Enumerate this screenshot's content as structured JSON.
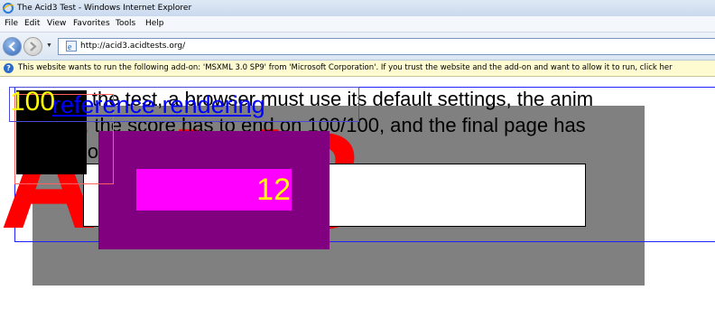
{
  "window": {
    "title": "The Acid3 Test - Windows Internet Explorer"
  },
  "menu": [
    "File",
    "Edit",
    "View",
    "Favorites",
    "Tools",
    "Help"
  ],
  "address": {
    "url": "http://acid3.acidtests.org/"
  },
  "infobar": {
    "text": "This website wants to run the following add-on: 'MSXML 3.0 SP9' from 'Microsoft Corporation'. If you trust the website and the add-on and want to allow it to run, click her"
  },
  "page": {
    "heading": "Acid3",
    "instructions_line1": "To pass the test, a browser must use its default settings, the anim",
    "instructions_line2": "smooth, the score has to end on 100/100, and the final page has",
    "instructions_line3": "look",
    "score": "100",
    "reference_link": "reference rendering",
    "counter": "12"
  },
  "colors": {
    "heading": "#ff0000",
    "score": "#ffff00",
    "link": "#0000ff",
    "grey_box": "#808080",
    "purple_box": "#800080",
    "magenta_bar": "#ff00ff"
  }
}
